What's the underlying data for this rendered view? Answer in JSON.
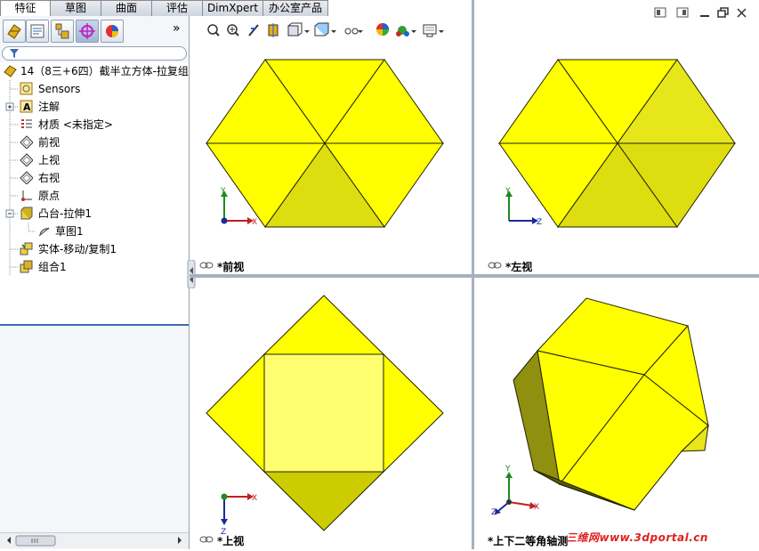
{
  "command_tabs": [
    "特征",
    "草图",
    "曲面",
    "评估",
    "DimXpert",
    "办公室产品"
  ],
  "left_pane": {
    "expand_glyph": "»",
    "tree": [
      {
        "label": "14（8三+6四）截半立方体-拉复组",
        "icon": "part-icon"
      },
      {
        "label": "Sensors",
        "icon": "sensors-icon"
      },
      {
        "label": "注解",
        "icon": "annotations-icon"
      },
      {
        "label": "材质 <未指定>",
        "icon": "material-icon"
      },
      {
        "label": "前视",
        "icon": "plane-icon"
      },
      {
        "label": "上视",
        "icon": "plane-icon"
      },
      {
        "label": "右视",
        "icon": "plane-icon"
      },
      {
        "label": "原点",
        "icon": "origin-icon"
      },
      {
        "label": "凸台-拉伸1",
        "icon": "extrude-icon"
      },
      {
        "label": "草图1",
        "icon": "sketch-icon"
      },
      {
        "label": "实体-移动/复制1",
        "icon": "move-copy-icon"
      },
      {
        "label": "组合1",
        "icon": "combine-icon"
      }
    ]
  },
  "viewports": {
    "front": "*前视",
    "left": "*左视",
    "top": "*上视",
    "iso": "*上下二等角轴测"
  },
  "axes": {
    "x": "X",
    "y": "Y",
    "z": "Z"
  },
  "watermark": "三维网www.3dportal.cn",
  "colors": {
    "face_light": "#ffff00",
    "face_mid": "#e8e81a",
    "face_dark": "#cccc00",
    "face_shadow": "#8f8f10",
    "edge": "#222200",
    "accent": "#3b6bb0"
  }
}
